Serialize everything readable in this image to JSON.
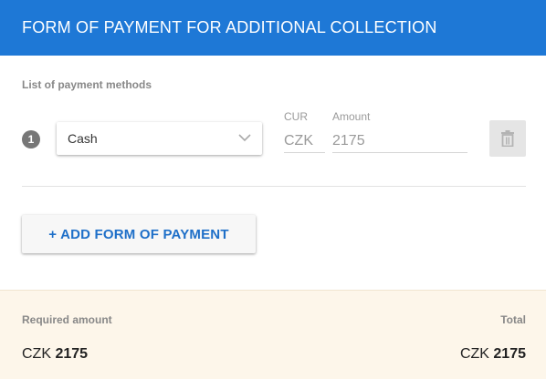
{
  "header": {
    "title": "FORM OF PAYMENT FOR ADDITIONAL COLLECTION"
  },
  "payments": {
    "section_label": "List of payment methods",
    "rows": [
      {
        "number": "1",
        "method": "Cash",
        "currency_label": "CUR",
        "currency": "CZK",
        "amount_label": "Amount",
        "amount": "2175",
        "delete_icon": "trash-icon"
      }
    ],
    "add_label": "+ ADD FORM OF PAYMENT"
  },
  "summary": {
    "required_label": "Required amount",
    "required_currency": "CZK",
    "required_value": "2175",
    "total_label": "Total",
    "total_currency": "CZK",
    "total_value": "2175"
  },
  "colors": {
    "header": "#1e78d6",
    "accent": "#1e6fc8",
    "footer_bg": "#fdf6ea"
  }
}
